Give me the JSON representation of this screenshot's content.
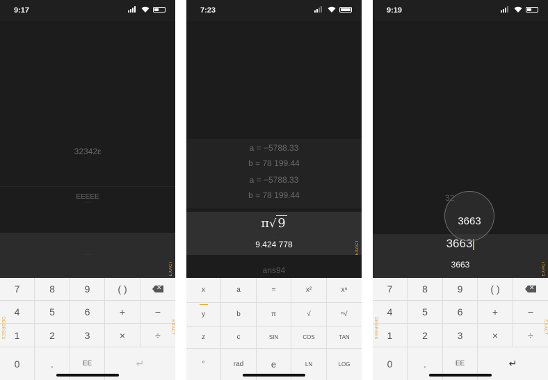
{
  "accent_color": "#e0a62a",
  "p1": {
    "time": "9:17",
    "history": [
      {
        "expr": "32342ε"
      },
      {
        "expr": "EEEEE"
      }
    ],
    "exact_label": "EXACT",
    "side_left": "DEGREES",
    "side_right": "EXACT",
    "keys": [
      "7",
      "8",
      "9",
      "( )",
      "4",
      "5",
      "6",
      "+",
      "−",
      "1",
      "2",
      "3",
      "×",
      "÷",
      "0",
      ".",
      "EE"
    ]
  },
  "p2": {
    "time": "7:23",
    "history": [
      "a = −5788.33",
      "b = 78 199.44",
      "a = −5788.33",
      "b = 78 199.44"
    ],
    "expr_symbol": "π",
    "expr_radicand": "9",
    "result": "9.424 778",
    "next_hint": "ans94",
    "exact_label": "EXACT",
    "keys": [
      "x",
      "a",
      "=",
      "x²",
      "xⁿ",
      "y",
      "b",
      "π",
      "√",
      "ⁿ√",
      "z",
      "c",
      "SIN",
      "COS",
      "TAN",
      "°",
      "rad",
      "e",
      "LN",
      "LOG"
    ]
  },
  "p3": {
    "time": "9:19",
    "magnifier_text": "3663",
    "history_faint": "32",
    "expr": "3663",
    "result": "3663",
    "exact_label": "EXACT",
    "side_left": "DEGREES",
    "side_right": "EXACT",
    "keys": [
      "7",
      "8",
      "9",
      "( )",
      "4",
      "5",
      "6",
      "+",
      "−",
      "1",
      "2",
      "3",
      "×",
      "÷",
      "0",
      ".",
      "EE"
    ]
  }
}
